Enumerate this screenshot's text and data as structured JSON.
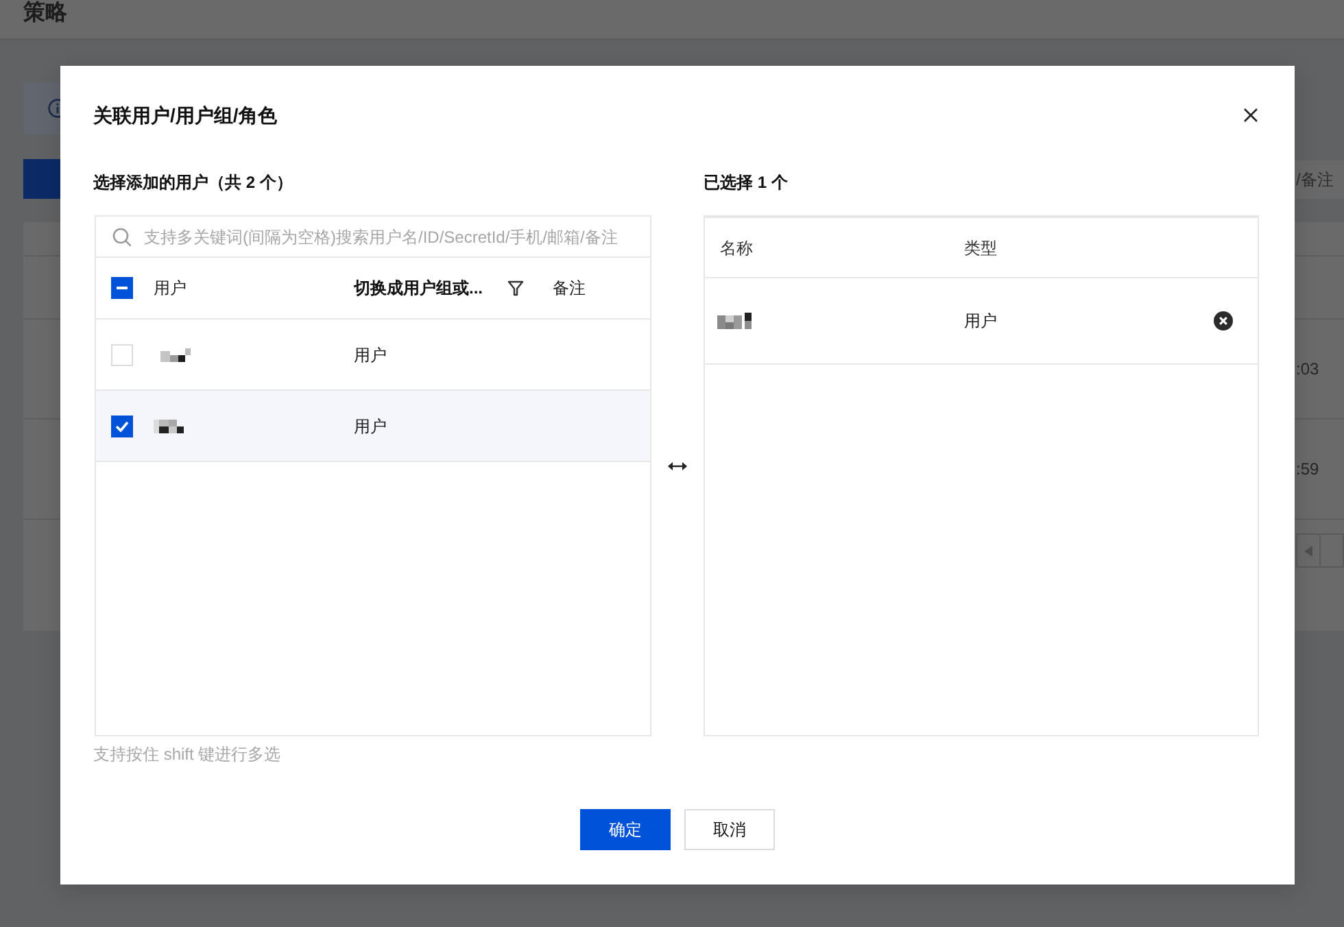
{
  "page": {
    "title": "策略",
    "search": {
      "placeholder": "/备注"
    },
    "table": {
      "rows": [
        {
          "column_1": ":03"
        },
        {
          "column_1": ":59"
        }
      ]
    }
  },
  "dialog": {
    "title": "关联用户/用户组/角色",
    "source": {
      "heading": "选择添加的用户（共 2 个）",
      "search": {
        "placeholder": "支持多关键词(间隔为空格)搜索用户名/ID/SecretId/手机/邮箱/备注"
      },
      "select_all": {
        "indeterminate": true
      },
      "columns": [
        {
          "label": "用户",
          "filter": false
        },
        {
          "label": "切换成用户组或...",
          "filter": true
        },
        {
          "label": "备注",
          "filter": false
        }
      ],
      "rows": [
        {
          "column_2": "用户",
          "checked": false
        },
        {
          "column_2": "用户",
          "checked": true
        }
      ],
      "hint": "支持按住 shift 键进行多选"
    },
    "target": {
      "heading": "已选择 1 个",
      "columns": [
        {
          "label": "名称"
        },
        {
          "label": "类型"
        }
      ],
      "rows": [
        {
          "type": "用户"
        }
      ]
    },
    "buttons": [
      {
        "label": "确定",
        "kind": "primary"
      },
      {
        "label": "取消",
        "kind": "secondary"
      }
    ]
  }
}
